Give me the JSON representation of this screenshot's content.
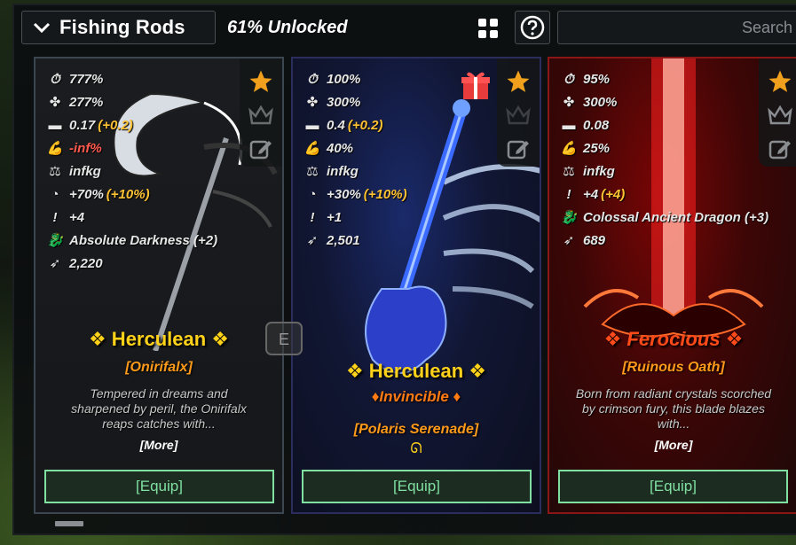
{
  "header": {
    "title": "Fishing Rods",
    "unlocked": "61% Unlocked"
  },
  "search": {
    "placeholder": "Search"
  },
  "colors": {
    "herculean": "#ffd21a",
    "ferocious": "#ff4a1a",
    "equip": "#7fe0a2",
    "bonus": "#ffc233"
  },
  "cards": [
    {
      "stats": {
        "lure": "777%",
        "luck": "277%",
        "control": "0.17",
        "control_bonus": "(+0.2)",
        "resilience": "-inf%",
        "max_weight": "infkg",
        "progress_speed": "+70%",
        "progress_bonus": "(+10%)",
        "surplus": "+4",
        "passive": "Absolute Darkness (+2)",
        "caught": "2,220"
      },
      "rarity": "❖ Herculean ❖",
      "name": "[Onirifalx]",
      "description": "Tempered in dreams and sharpened by peril, the Onirifalx reaps catches with...",
      "more": "[More]",
      "equip": "[Equip]"
    },
    {
      "stats": {
        "lure": "100%",
        "luck": "300%",
        "control": "0.4",
        "control_bonus": "(+0.2)",
        "resilience": "40%",
        "max_weight": "infkg",
        "progress_speed": "+30%",
        "progress_bonus": "(+10%)",
        "surplus": "+1",
        "caught": "2,501"
      },
      "rarity": "❖ Herculean ❖",
      "mutation": "♦Invincible ♦",
      "name": "[Polaris Serenade]",
      "equip": "[Equip]"
    },
    {
      "stats": {
        "lure": "95%",
        "luck": "300%",
        "control": "0.08",
        "resilience": "25%",
        "max_weight": "infkg",
        "surplus": "+4",
        "surplus_bonus": "(+4)",
        "passive": "Colossal Ancient Dragon (+3)",
        "caught": "689"
      },
      "rarity": "❖ Ferocious ❖",
      "name": "[Ruinous Oath]",
      "description": "Born from radiant crystals scorched by crimson fury, this blade blazes with...",
      "more": "[More]",
      "equip": "[Equip]"
    }
  ]
}
